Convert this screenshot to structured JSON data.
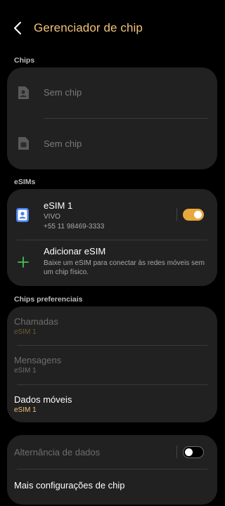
{
  "header": {
    "title": "Gerenciador de chip"
  },
  "sections": {
    "chips": "Chips",
    "esims": "eSIMs",
    "preferred": "Chips preferenciais"
  },
  "chips": [
    {
      "label": "Sem chip"
    },
    {
      "label": "Sem chip"
    }
  ],
  "esim": {
    "name": "eSIM 1",
    "carrier": "VIVO",
    "number": "+55 11 98469-3333",
    "toggle_on": true
  },
  "add_esim": {
    "title": "Adicionar eSIM",
    "description": "Baixe um eSIM para conectar às redes móveis sem um chip físico."
  },
  "preferred": [
    {
      "title": "Chamadas",
      "value": "eSIM 1",
      "enabled": false
    },
    {
      "title": "Mensagens",
      "value": "eSIM 1",
      "enabled": false
    },
    {
      "title": "Dados móveis",
      "value": "eSIM 1",
      "enabled": true
    }
  ],
  "bottom": {
    "data_switch": "Alternância de dados",
    "data_switch_on": false,
    "more": "Mais configurações de chip"
  },
  "colors": {
    "accent": "#f1c27a",
    "toggle_on": "#e7a93b",
    "add_icon": "#43c05a",
    "esim_icon": "#4a82ef"
  }
}
